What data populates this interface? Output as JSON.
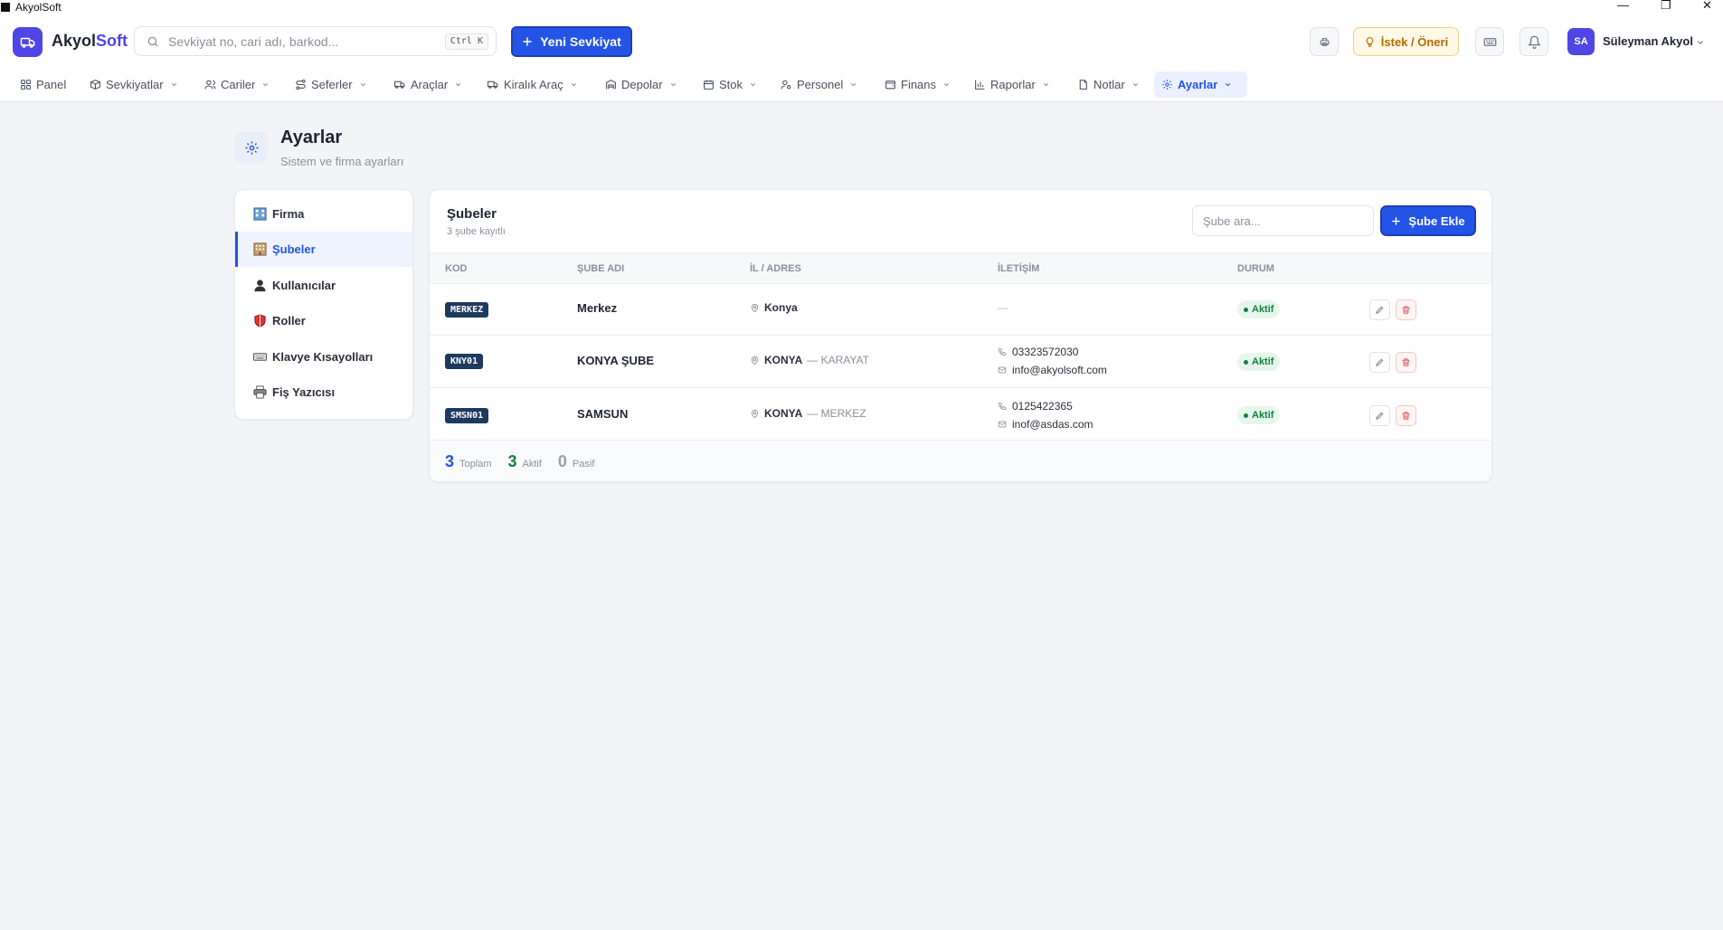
{
  "window": {
    "title": "AkyolSoft"
  },
  "header": {
    "logo_part1": "Akyol",
    "logo_part2": "Soft",
    "search_placeholder": "Sevkiyat no, cari adı, barkod...",
    "search_shortcut": "Ctrl K",
    "new_shipment_label": "Yeni Sevkiyat",
    "suggest_label": "İstek / Öneri",
    "user_initials": "SA",
    "user_name": "Süleyman Akyol"
  },
  "nav": {
    "items": [
      {
        "label": "Panel",
        "icon": "grid-icon"
      },
      {
        "label": "Sevkiyatlar",
        "icon": "box-icon"
      },
      {
        "label": "Cariler",
        "icon": "users-icon"
      },
      {
        "label": "Seferler",
        "icon": "route-icon"
      },
      {
        "label": "Araçlar",
        "icon": "truck-icon"
      },
      {
        "label": "Kiralık Araç",
        "icon": "truck-icon"
      },
      {
        "label": "Depolar",
        "icon": "warehouse-icon"
      },
      {
        "label": "Stok",
        "icon": "calendar-icon"
      },
      {
        "label": "Personel",
        "icon": "user-key-icon"
      },
      {
        "label": "Finans",
        "icon": "wallet-icon"
      },
      {
        "label": "Raporlar",
        "icon": "bar-chart-icon"
      },
      {
        "label": "Notlar",
        "icon": "file-icon"
      },
      {
        "label": "Ayarlar",
        "icon": "gear-icon"
      }
    ]
  },
  "page": {
    "title": "Ayarlar",
    "subtitle": "Sistem ve firma ayarları"
  },
  "side_menu": {
    "items": [
      {
        "label": "Firma"
      },
      {
        "label": "Şubeler"
      },
      {
        "label": "Kullanıcılar"
      },
      {
        "label": "Roller"
      },
      {
        "label": "Klavye Kısayolları"
      },
      {
        "label": "Fiş Yazıcısı"
      }
    ],
    "active_index": 1
  },
  "branches": {
    "title": "Şubeler",
    "subtitle": "3 şube kayıtlı",
    "search_placeholder": "Şube ara...",
    "add_label": "Şube Ekle",
    "columns": [
      "KOD",
      "ŞUBE ADI",
      "İL / ADRES",
      "İLETİŞİM",
      "DURUM"
    ],
    "rows": [
      {
        "code": "MERKEZ",
        "name": "Merkez",
        "city": "Konya",
        "district": "",
        "phone": "",
        "email": "",
        "no_contact": "—",
        "status": "Aktif"
      },
      {
        "code": "KNY01",
        "name": "KONYA ŞUBE",
        "city": "KONYA",
        "district": "— KARAYAT",
        "phone": "03323572030",
        "email": "info@akyolsoft.com",
        "no_contact": "",
        "status": "Aktif"
      },
      {
        "code": "SMSN01",
        "name": "SAMSUN",
        "city": "KONYA",
        "district": "— MERKEZ",
        "phone": "0125422365",
        "email": "inof@asdas.com",
        "no_contact": "",
        "status": "Aktif"
      }
    ],
    "totals": {
      "total_count": "3",
      "total_label": "Toplam",
      "active_count": "3",
      "active_label": "Aktif",
      "passive_count": "0",
      "passive_label": "Pasif"
    }
  },
  "colors": {
    "primary": "#2454e6",
    "brand": "#4f46e5",
    "success": "#14803c",
    "danger": "#e5484d"
  }
}
